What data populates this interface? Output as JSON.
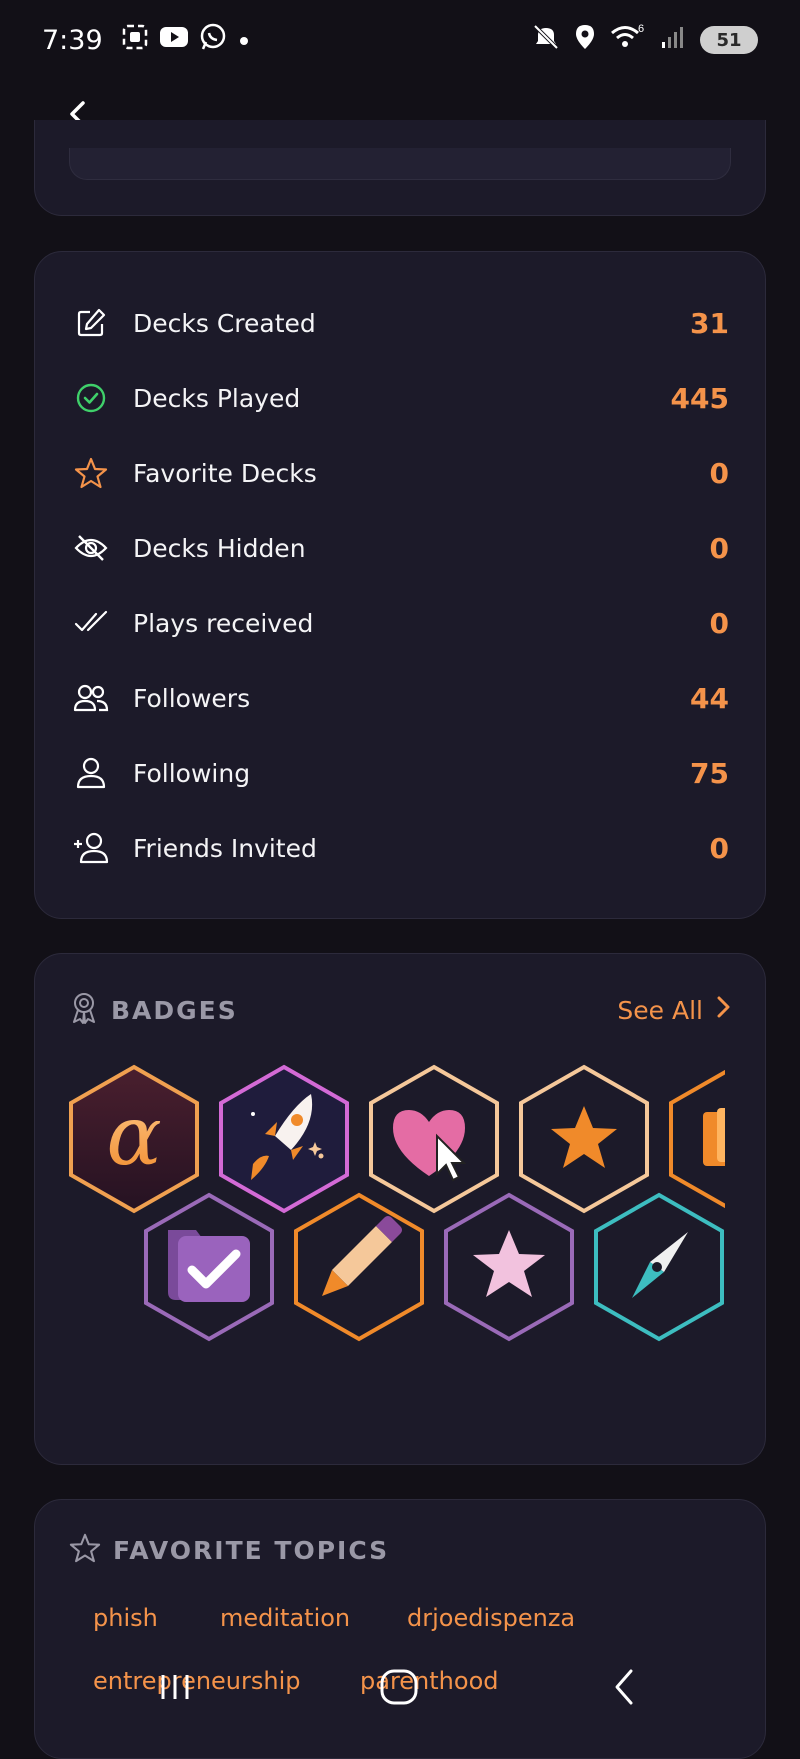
{
  "status_bar": {
    "time": "7:39",
    "battery": "51",
    "left_icons": [
      "screen-record-icon",
      "youtube-icon",
      "whatsapp-icon",
      "dot-icon"
    ],
    "right_icons": [
      "mute-icon",
      "location-icon",
      "wifi-icon",
      "signal-icon",
      "battery-icon"
    ],
    "wifi_badge": "6"
  },
  "topbar": {
    "back_icon": "chevron-left-icon"
  },
  "stats": {
    "items": [
      {
        "label": "Decks Created",
        "value": "31",
        "icon": "edit-icon"
      },
      {
        "label": "Decks Played",
        "value": "445",
        "icon": "check-circle-icon"
      },
      {
        "label": "Favorite Decks",
        "value": "0",
        "icon": "star-outline-icon"
      },
      {
        "label": "Decks Hidden",
        "value": "0",
        "icon": "eye-off-icon"
      },
      {
        "label": "Plays received",
        "value": "0",
        "icon": "double-check-icon"
      },
      {
        "label": "Followers",
        "value": "44",
        "icon": "users-icon"
      },
      {
        "label": "Following",
        "value": "75",
        "icon": "user-icon"
      },
      {
        "label": "Friends Invited",
        "value": "0",
        "icon": "user-plus-icon"
      }
    ]
  },
  "badges": {
    "title": "BADGES",
    "see_all": "See All",
    "items": [
      {
        "name": "alpha-badge",
        "border": "#f0a050",
        "fill": "#3a1a2c"
      },
      {
        "name": "rocket-badge",
        "border": "#d36ad6",
        "fill": "#1e1b3a"
      },
      {
        "name": "heart-cursor-badge",
        "border": "#f5c89a",
        "fill": "#1c1a29"
      },
      {
        "name": "star-badge",
        "border": "#f5c89a",
        "fill": "#1c1a29"
      },
      {
        "name": "partial-badge",
        "border": "#f08a2a",
        "fill": "#1c1a29"
      },
      {
        "name": "folder-check-badge",
        "border": "#9a6ab8",
        "fill": "#1c1a29"
      },
      {
        "name": "pencil-badge",
        "border": "#f08a2a",
        "fill": "#1c1a29"
      },
      {
        "name": "pink-star-badge",
        "border": "#9a6ab8",
        "fill": "#1c1a29"
      },
      {
        "name": "compass-badge",
        "border": "#3dbdc0",
        "fill": "#1c1a29"
      }
    ]
  },
  "favorite_topics": {
    "title": "FAVORITE TOPICS",
    "topics": [
      "phish",
      "meditation",
      "drjoedispenza",
      "entrepreneurship",
      "parenthood"
    ]
  },
  "navbar": {
    "icons": [
      "recent-apps-icon",
      "home-icon",
      "back-nav-icon"
    ]
  },
  "colors": {
    "accent": "#f4934a",
    "card": "#1c1a29",
    "background": "#121017"
  }
}
